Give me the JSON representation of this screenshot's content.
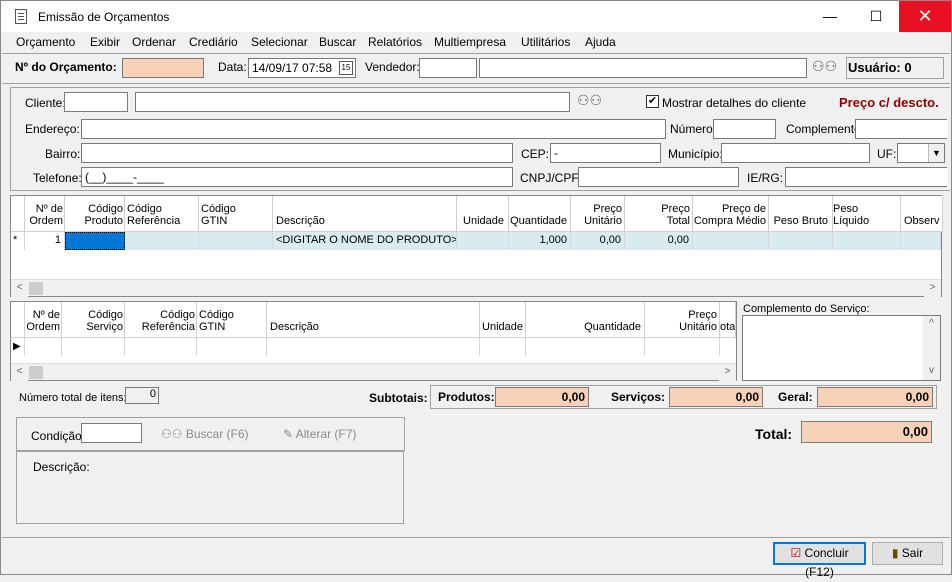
{
  "window": {
    "title": "Emissão de Orçamentos",
    "minimize": "—",
    "maximize": "☐",
    "close": "✕"
  },
  "menu": [
    "Orçamento",
    "Exibir",
    "Ordenar",
    "Crediário",
    "Selecionar",
    "Buscar",
    "Relatórios",
    "Multiempresa",
    "Utilitários",
    "Ajuda"
  ],
  "header": {
    "numero_label": "Nº do Orçamento:",
    "numero_value": "",
    "data_label": "Data:",
    "data_value": "14/09/17 07:58",
    "vendedor_label": "Vendedor:",
    "vendedor_code": "",
    "vendedor_name": "",
    "usuario_label": "Usuário: 0"
  },
  "client": {
    "cliente_label": "Cliente:",
    "mostrar_label": "Mostrar detalhes do cliente",
    "mostrar_checked": true,
    "preco_label": "Preço c/ descto.",
    "endereco_label": "Endereço:",
    "numero_label": "Número:",
    "complemento_label": "Complemento:",
    "bairro_label": "Bairro:",
    "cep_label": "CEP:",
    "cep_value": "     -",
    "municipio_label": "Município:",
    "uf_label": "UF:",
    "telefone_label": "Telefone:",
    "telefone_value": "(__)____-____",
    "cnpj_label": "CNPJ/CPF:",
    "ie_label": "IE/RG:"
  },
  "products": {
    "columns": [
      {
        "l1": "Nº de",
        "l2": "Ordem"
      },
      {
        "l1": "Código",
        "l2": "Produto"
      },
      {
        "l1": "Código",
        "l2": "Referência"
      },
      {
        "l1": "Código",
        "l2": "GTIN"
      },
      {
        "l1": "",
        "l2": "Descrição"
      },
      {
        "l1": "",
        "l2": "Unidade"
      },
      {
        "l1": "",
        "l2": "Quantidade"
      },
      {
        "l1": "Preço",
        "l2": "Unitário"
      },
      {
        "l1": "Preço",
        "l2": "Total"
      },
      {
        "l1": "Preço de",
        "l2": "Compra Médio"
      },
      {
        "l1": "",
        "l2": "Peso Bruto"
      },
      {
        "l1": "",
        "l2": "Peso Líquido"
      },
      {
        "l1": "",
        "l2": "Observ"
      }
    ],
    "row": {
      "marker": "*",
      "ordem": "1",
      "descricao": "<DIGITAR O NOME DO PRODUTO>",
      "quantidade": "1,000",
      "unitario": "0,00",
      "total": "0,00"
    }
  },
  "services": {
    "columns": [
      {
        "l1": "Nº de",
        "l2": "Ordem"
      },
      {
        "l1": "Código",
        "l2": "Serviço"
      },
      {
        "l1": "Código",
        "l2": "Referência"
      },
      {
        "l1": "Código",
        "l2": "GTIN"
      },
      {
        "l1": "",
        "l2": "Descrição"
      },
      {
        "l1": "",
        "l2": "Unidade"
      },
      {
        "l1": "",
        "l2": "Quantidade"
      },
      {
        "l1": "Preço",
        "l2": "Unitário"
      },
      {
        "l1": "",
        "l2": "otal"
      }
    ],
    "row_marker": "▶",
    "complemento_label": "Complemento do Serviço:"
  },
  "totals": {
    "num_itens_label": "Número total de itens:",
    "num_itens_value": "0",
    "subtotais_label": "Subtotais:",
    "produtos_label": "Produtos:",
    "produtos_value": "0,00",
    "servicos_label": "Serviços:",
    "servicos_value": "0,00",
    "geral_label": "Geral:",
    "geral_value": "0,00",
    "total_label": "Total:",
    "total_value": "0,00"
  },
  "condicao": {
    "label": "Condição:",
    "buscar": "Buscar (F6)",
    "alterar": "Alterar (F7)",
    "descricao_label": "Descrição:"
  },
  "buttons": {
    "concluir": "Concluir (F12)",
    "sair": "Sair"
  },
  "colors": {
    "peach": "#f8d2b8",
    "selected_row": "#d8ecf0",
    "selected_cell": "#0078d7",
    "preco_red": "#8b0000"
  }
}
